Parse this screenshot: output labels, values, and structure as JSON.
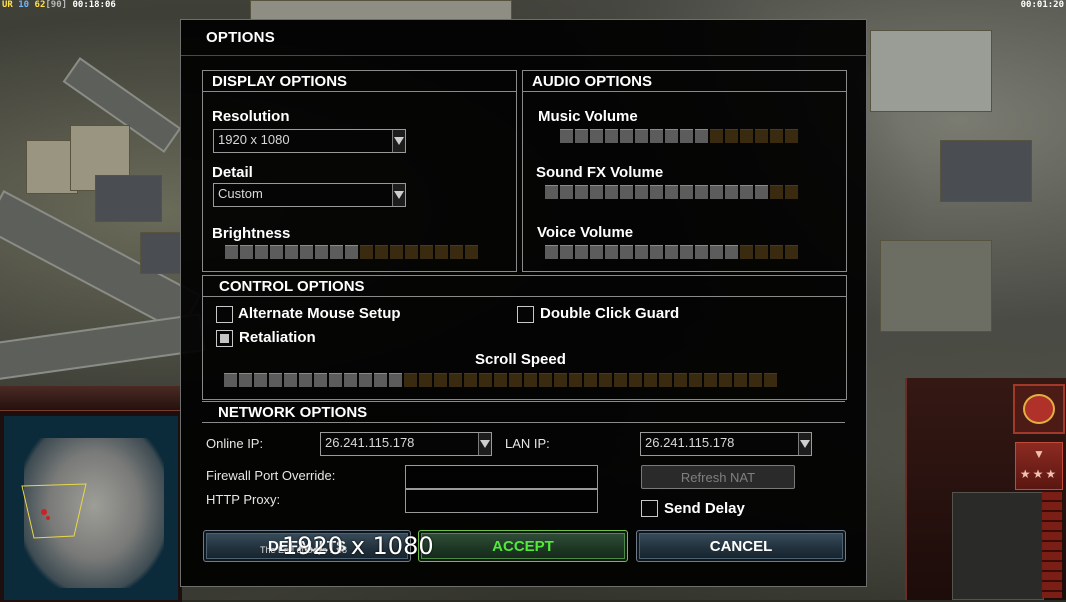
{
  "hud": {
    "left_tag": "UR",
    "left_num1": "10",
    "left_num2": "62",
    "left_bracket": "[90]",
    "left_time": "00:18:06",
    "right_time": "00:01:20"
  },
  "dialog": {
    "title": "OPTIONS",
    "display": {
      "heading": "DISPLAY OPTIONS",
      "resolution_label": "Resolution",
      "resolution_value": "1920 x 1080",
      "detail_label": "Detail",
      "detail_value": "Custom",
      "brightness_label": "Brightness",
      "brightness_level": 9,
      "brightness_total": 17
    },
    "audio": {
      "heading": "AUDIO OPTIONS",
      "music_label": "Music Volume",
      "music_level": 10,
      "music_total": 16,
      "sfx_label": "Sound FX Volume",
      "sfx_level": 15,
      "sfx_total": 17,
      "voice_label": "Voice Volume",
      "voice_level": 13,
      "voice_total": 17
    },
    "control": {
      "heading": "CONTROL OPTIONS",
      "alt_mouse_label": "Alternate Mouse Setup",
      "alt_mouse_checked": false,
      "double_click_label": "Double Click Guard",
      "double_click_checked": false,
      "retaliation_label": "Retaliation",
      "retaliation_checked": true,
      "scroll_label": "Scroll Speed",
      "scroll_level": 12,
      "scroll_total": 37
    },
    "network": {
      "heading": "NETWORK OPTIONS",
      "online_ip_label": "Online IP:",
      "online_ip_value": "26.241.115.178",
      "lan_ip_label": "LAN IP:",
      "lan_ip_value": "26.241.115.178",
      "firewall_label": "Firewall Port Override:",
      "firewall_value": "",
      "proxy_label": "HTTP Proxy:",
      "proxy_value": "",
      "refresh_nat_label": "Refresh NAT",
      "send_delay_label": "Send Delay",
      "send_delay_checked": false
    },
    "buttons": {
      "defaults": "DEFAULTS",
      "accept": "ACCEPT",
      "cancel": "CANCEL"
    },
    "overlay_resolution": "1920 x 1080",
    "overlay_small": "The End of Days 1.08"
  },
  "icons": {
    "dropdown": "chevron-down-icon",
    "badge": "faction-emblem-icon",
    "stars": "rank-stars-icon"
  },
  "colors": {
    "accept_text": "#54e83a",
    "slider_on": "#5c5c5c",
    "slider_off": "#3a2a10",
    "panel_border": "#8a8a8a"
  }
}
